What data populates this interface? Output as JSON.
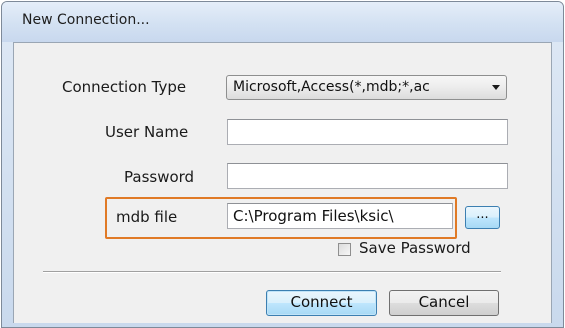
{
  "dialog": {
    "title": "New Connection..."
  },
  "form": {
    "connection_type": {
      "label": "Connection Type",
      "selected": "Microsoft,Access(*,mdb;*,ac"
    },
    "user_name": {
      "label": "User Name",
      "value": ""
    },
    "password": {
      "label": "Password",
      "value": ""
    },
    "mdb_file": {
      "label": "mdb file",
      "value": "C:\\Program Files\\ksic\\",
      "browse_label": "..."
    },
    "save_password": {
      "label": "Save Password",
      "checked": false
    }
  },
  "buttons": {
    "connect": "Connect",
    "cancel": "Cancel"
  },
  "colors": {
    "highlight": "#e07a26",
    "title_bar": "#d3e1f2",
    "client_bg": "#f0f0f0",
    "default_button_border": "#3c7fb1"
  }
}
